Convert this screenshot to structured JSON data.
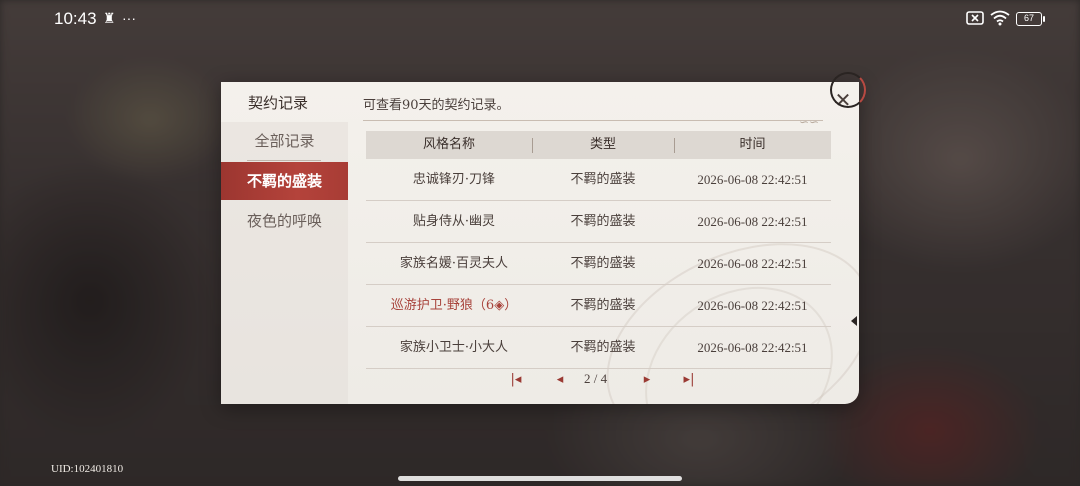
{
  "status_bar": {
    "time": "10:43",
    "dots": "···",
    "battery": "67"
  },
  "dialog": {
    "title": "契约记录",
    "subtitle": "可查看90天的契约记录。",
    "close": "✕"
  },
  "sidebar": {
    "items": [
      {
        "label": "全部记录",
        "active": false
      },
      {
        "label": "不羁的盛装",
        "active": true
      },
      {
        "label": "夜色的呼唤",
        "active": false
      }
    ]
  },
  "table": {
    "headers": [
      "风格名称",
      "类型",
      "时间"
    ],
    "rows": [
      {
        "name": "忠诚锋刃·刀锋",
        "type": "不羁的盛装",
        "time": "2026-06-08 22:42:51",
        "highlight": false
      },
      {
        "name": "贴身侍从·幽灵",
        "type": "不羁的盛装",
        "time": "2026-06-08 22:42:51",
        "highlight": false
      },
      {
        "name": "家族名媛·百灵夫人",
        "type": "不羁的盛装",
        "time": "2026-06-08 22:42:51",
        "highlight": false
      },
      {
        "name": "巡游护卫·野狼（6◈）",
        "type": "不羁的盛装",
        "time": "2026-06-08 22:42:51",
        "highlight": true
      },
      {
        "name": "家族小卫士·小大人",
        "type": "不羁的盛装",
        "time": "2026-06-08 22:42:51",
        "highlight": false
      }
    ]
  },
  "pagination": {
    "page_text": "2 / 4",
    "first": "|◂",
    "prev": "◂",
    "next": "▸",
    "last": "▸|"
  },
  "footer": {
    "uid": "UID:102401810"
  }
}
